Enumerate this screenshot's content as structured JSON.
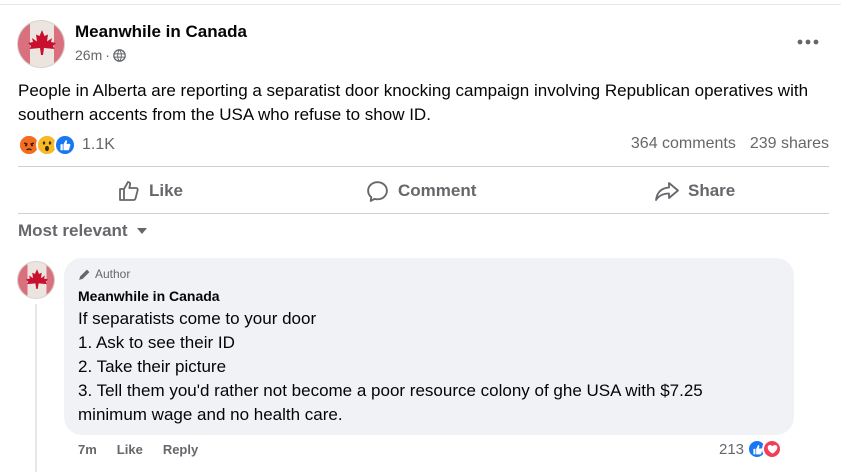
{
  "post": {
    "page_name": "Meanwhile in Canada",
    "time": "26m",
    "separator": "·",
    "text": "People in Alberta are reporting a separatist door knocking campaign involving Republican operatives with southern accents from the USA who refuse to show ID.",
    "reaction_count": "1.1K",
    "comments": "364 comments",
    "shares": "239 shares",
    "reaction_icons": [
      "angry-icon",
      "wow-icon",
      "like-icon"
    ]
  },
  "actions": {
    "like": "Like",
    "comment": "Comment",
    "share": "Share"
  },
  "sort": {
    "label": "Most relevant"
  },
  "comment": {
    "badge": "Author",
    "name": "Meanwhile in Canada",
    "lines": [
      "If separatists come to your door",
      "1. Ask to see their ID",
      "2. Take their picture",
      "3. Tell them you'd rather not become a poor resource colony of ghe USA with $7.25",
      "minimum wage and no health care."
    ],
    "time": "7m",
    "like": "Like",
    "reply": "Reply",
    "reaction_count": "213",
    "reaction_icons": [
      "like-icon",
      "love-icon"
    ]
  },
  "colors": {
    "text_primary": "#050505",
    "text_secondary": "#65676b",
    "like_blue": "#1877f2",
    "love_red": "#f33e58",
    "angry_orange": "#e9710f",
    "wow_yellow": "#f7b928",
    "bubble_bg": "#f0f2f5",
    "divider": "#ced0d4",
    "maple_red": "#c8102e"
  }
}
